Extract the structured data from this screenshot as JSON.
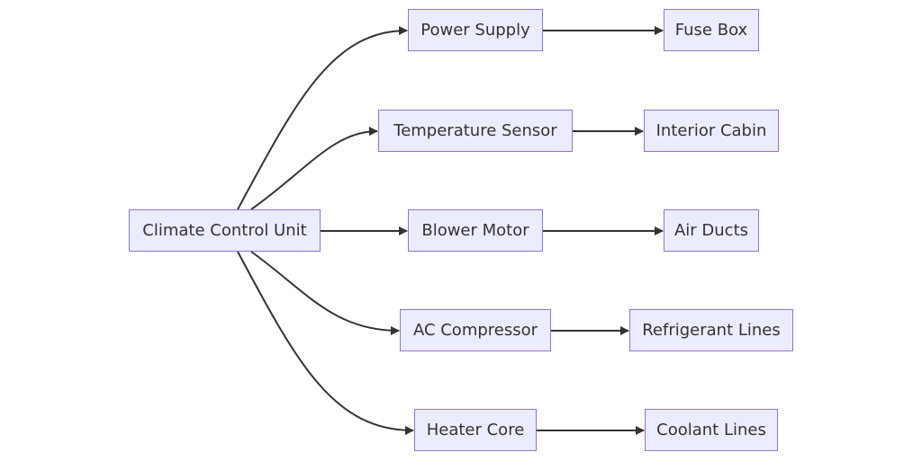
{
  "diagram": {
    "type": "flowchart-lr",
    "colors": {
      "node_fill": "#ececff",
      "node_stroke": "#9370db",
      "edge": "#333333",
      "text": "#333333"
    },
    "nodes": {
      "ccu": "Climate Control Unit",
      "power": "Power Supply",
      "temp": "Temperature Sensor",
      "blower": "Blower Motor",
      "ac": "AC Compressor",
      "heater": "Heater Core",
      "fuse": "Fuse Box",
      "cabin": "Interior Cabin",
      "ducts": "Air Ducts",
      "refrig": "Refrigerant Lines",
      "coolant": "Coolant Lines"
    },
    "edges": [
      [
        "ccu",
        "power"
      ],
      [
        "ccu",
        "temp"
      ],
      [
        "ccu",
        "blower"
      ],
      [
        "ccu",
        "ac"
      ],
      [
        "ccu",
        "heater"
      ],
      [
        "power",
        "fuse"
      ],
      [
        "temp",
        "cabin"
      ],
      [
        "blower",
        "ducts"
      ],
      [
        "ac",
        "refrig"
      ],
      [
        "heater",
        "coolant"
      ]
    ]
  }
}
